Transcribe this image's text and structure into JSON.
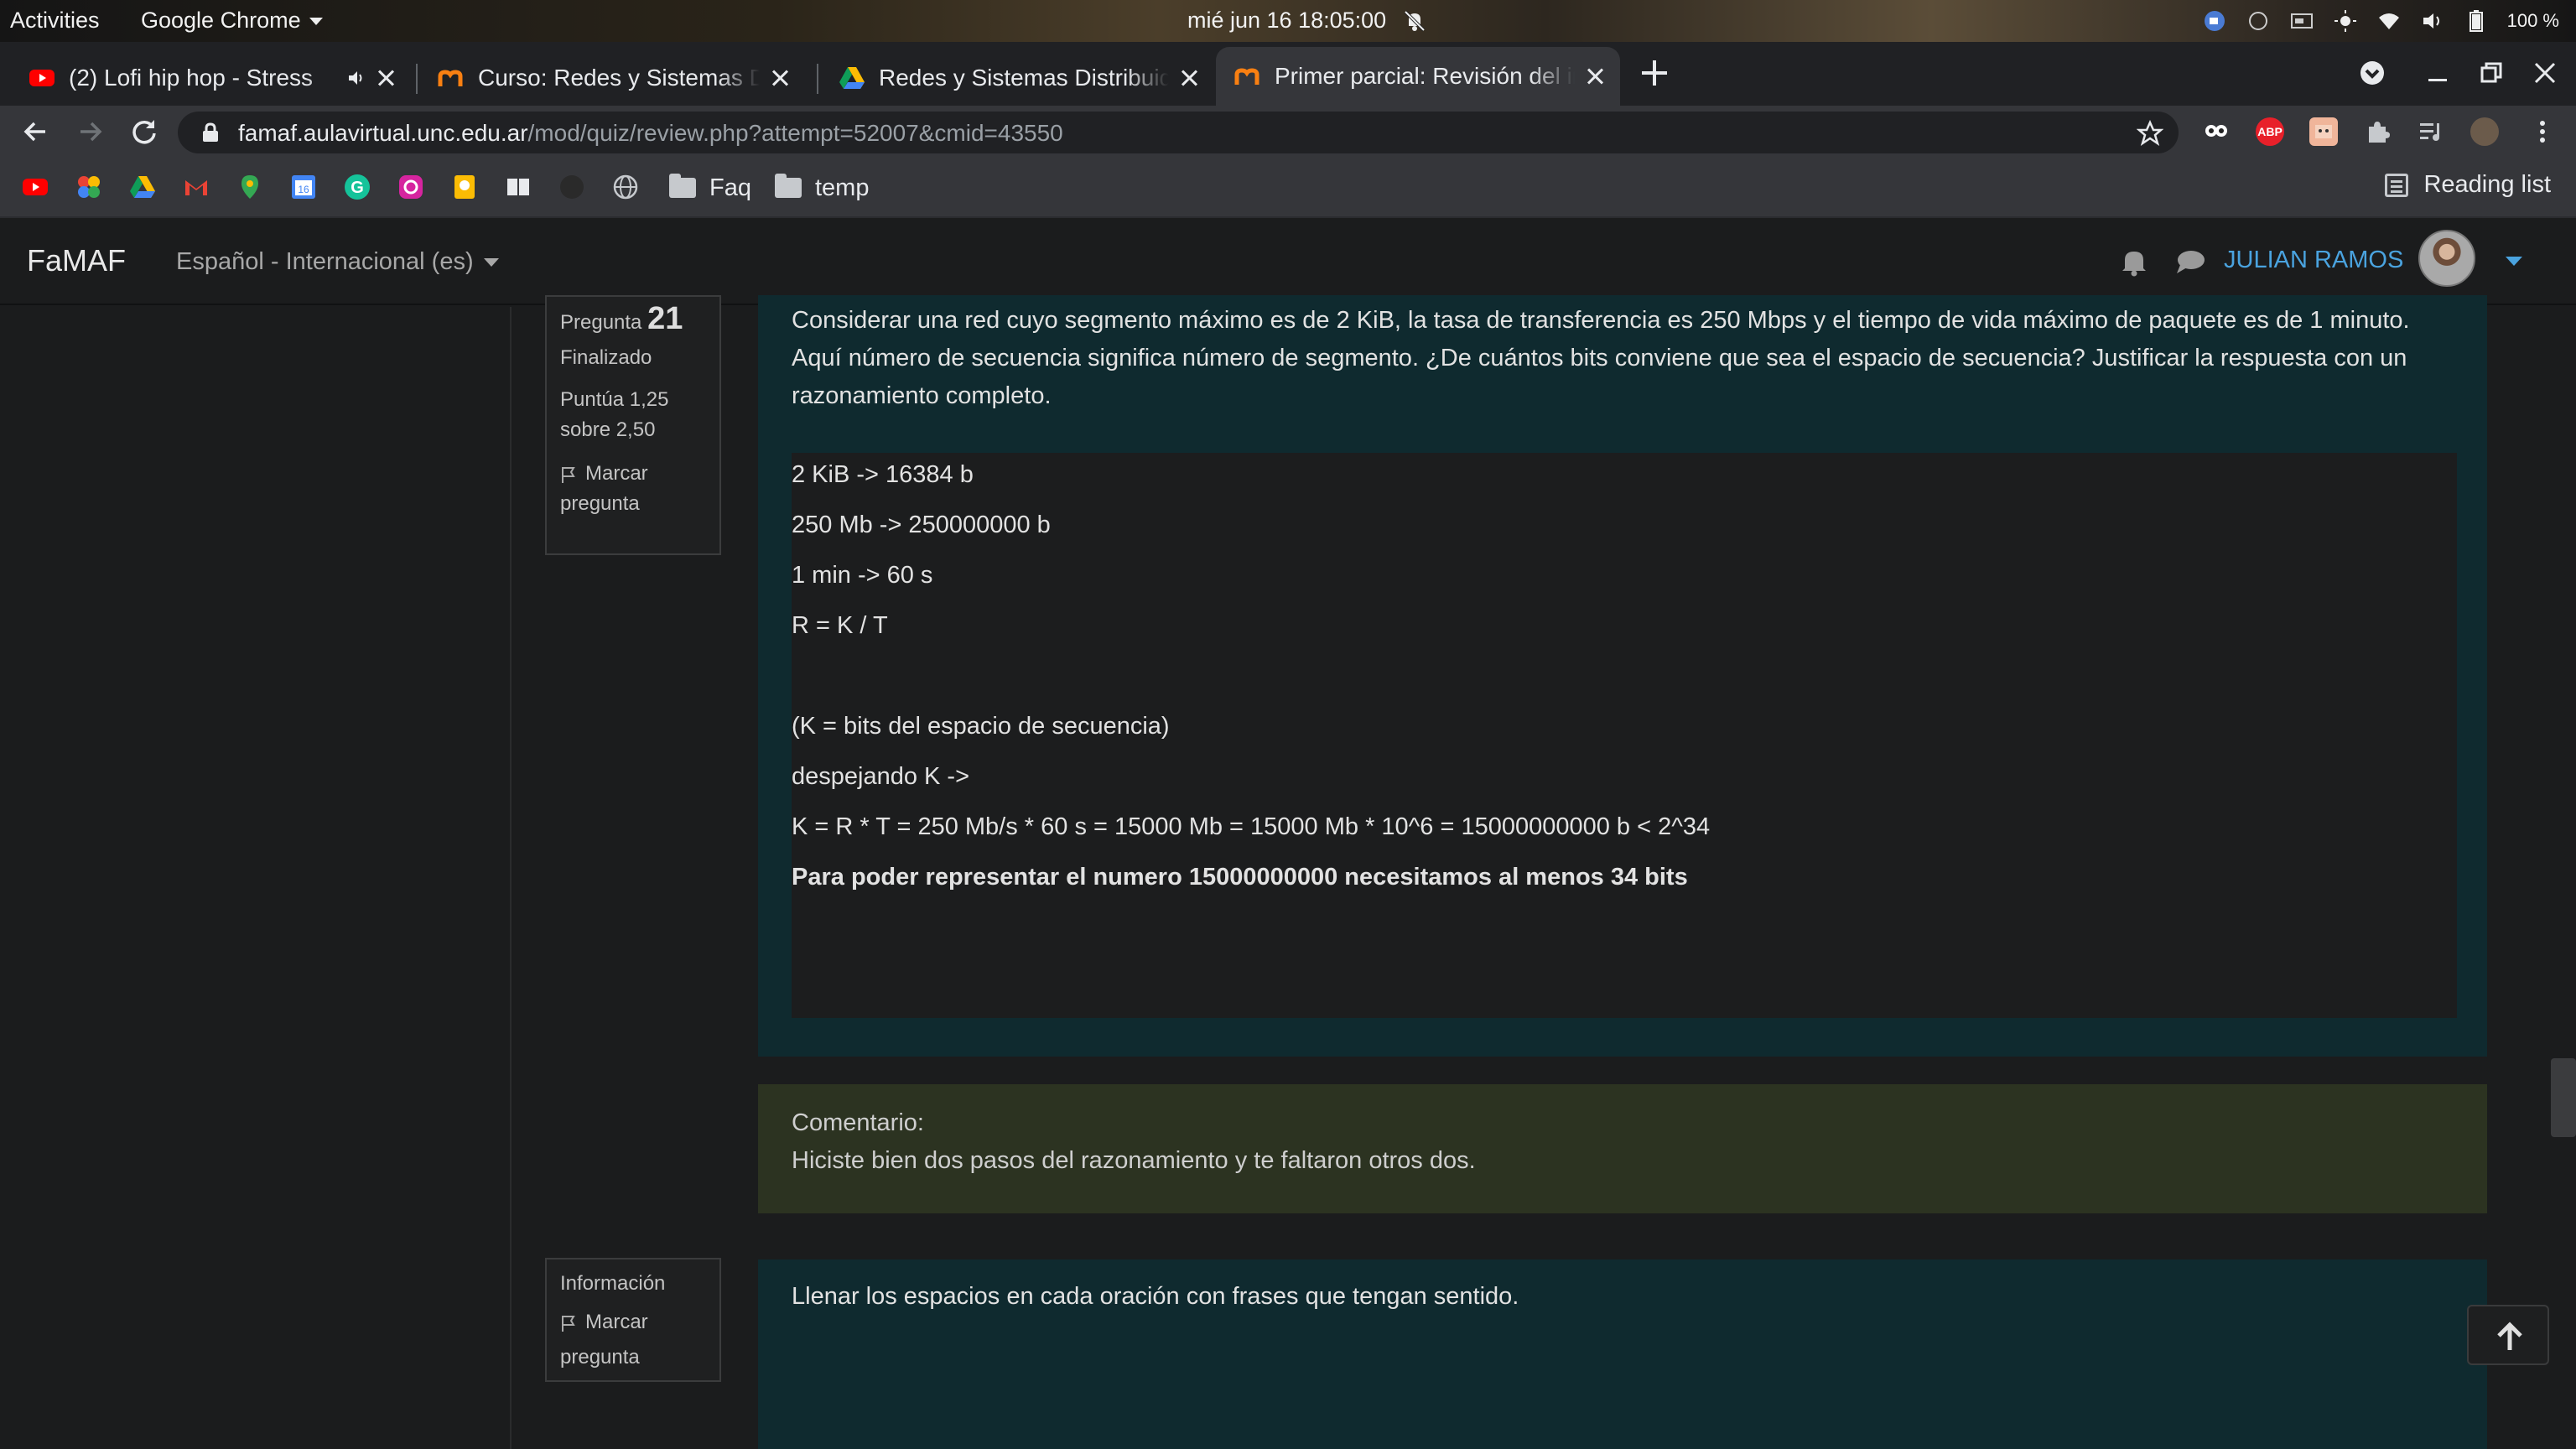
{
  "system_bar": {
    "activities": "Activities",
    "app_name": "Google Chrome",
    "clock": "mié jun 16  18:05:00",
    "battery": "100 %"
  },
  "tabs": [
    {
      "title": "(2) Lofi hip hop - Stress",
      "favicon": "youtube-icon"
    },
    {
      "title": "Curso: Redes y Sistemas Distribuidos",
      "favicon": "moodle-icon"
    },
    {
      "title": "Redes y Sistemas Distribuidos",
      "favicon": "drive-icon"
    },
    {
      "title": "Primer parcial: Revisión del intento",
      "favicon": "moodle-icon",
      "active": true
    }
  ],
  "address_bar": {
    "host": "famaf.aulavirtual.unc.edu.ar",
    "path": "/mod/quiz/review.php?attempt=52007&cmid=43550"
  },
  "bookmarks": {
    "folders": [
      "Faq",
      "temp"
    ],
    "reading_list": "Reading list"
  },
  "site_nav": {
    "brand": "FaMAF",
    "language": "Español - Internacional (es)",
    "user_name": "JULIAN RAMOS"
  },
  "question21": {
    "label": "Pregunta",
    "number": "21",
    "state": "Finalizado",
    "grade_line1": "Puntúa 1,25",
    "grade_line2": "sobre 2,50",
    "flag_line1": "Marcar",
    "flag_line2": "pregunta",
    "text": "Considerar una red cuyo segmento máximo es de  2 KiB, la tasa de transferencia es 250 Mbps y el tiempo de vida máximo de paquete es de 1 minuto.  Aquí número de secuencia significa número de segmento. ¿De cuántos bits conviene que sea el espacio de secuencia?  Justificar la respuesta con un razonamiento completo.",
    "answer_lines": [
      "2 KiB     ->  16384 b",
      "250 Mb -> 250000000 b",
      "1 min -> 60 s",
      "R = K / T",
      "",
      "(K = bits del espacio de secuencia)",
      "despejando K ->",
      "K = R * T = 250 Mb/s * 60 s = 15000 Mb = 15000 Mb * 10^6 = 15000000000 b < 2^34",
      "Para poder representar el numero 15000000000 necesitamos al menos 34 bits"
    ],
    "comment_title": "Comentario:",
    "comment_text": "Hiciste bien dos pasos del razonamiento y te faltaron otros dos."
  },
  "info_block": {
    "label": "Información",
    "flag_line1": "Marcar",
    "flag_line2": "pregunta",
    "text": "Llenar los espacios en cada oración con frases que tengan sentido."
  },
  "colors": {
    "question_bg": "#0f2a2f",
    "comment_bg": "#2c3321",
    "link": "#4aa3df"
  }
}
